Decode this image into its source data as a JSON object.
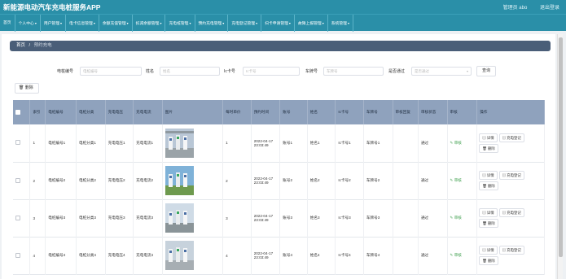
{
  "app": {
    "title": "新能源电动汽车充电桩服务APP",
    "user_links": [
      "管理员 abo",
      "退出登录"
    ]
  },
  "nav": [
    "首页",
    "个人中心",
    "用户管理",
    "电卡信息管理",
    "余额充值管理",
    "扣减余额管理",
    "充电桩管理",
    "预约充电管理",
    "充电登记管理",
    "扫卡申请管理",
    "故障上报管理",
    "系统管理"
  ],
  "nav_dropdown": [
    false,
    true,
    true,
    true,
    true,
    true,
    true,
    true,
    true,
    true,
    true,
    true
  ],
  "breadcrumb": {
    "home": "首页",
    "sep": "/",
    "current": "预约充电"
  },
  "filters": {
    "pile_no_label": "电桩编号",
    "pile_no_placeholder": "电桩编号",
    "name_label": "姓名",
    "name_placeholder": "姓名",
    "card_label": "Ic卡号",
    "card_placeholder": "Ic卡号",
    "plate_label": "车牌号",
    "plate_placeholder": "车牌号",
    "passed_label": "是否通过",
    "passed_placeholder": "是否通过",
    "search_button": "查询"
  },
  "delete_button": "删除",
  "table": {
    "headers": [
      "索引",
      "电桩编号",
      "电桩分类",
      "充电电压",
      "充电电流",
      "图片",
      "每时单价",
      "预约时间",
      "账号",
      "姓名",
      "Ic卡号",
      "车牌号",
      "审核回复",
      "审核状态",
      "审核",
      "操作"
    ],
    "rows": [
      {
        "index": "1",
        "pile_no": "电桩编号1",
        "category": "电桩分类1",
        "voltage": "充电电压1",
        "current": "充电电流1",
        "price": "1",
        "time": "2022-04-17 23:03:49",
        "account": "账号1",
        "name": "姓名1",
        "card": "Ic卡号1",
        "plate": "车牌号1",
        "reply": "",
        "status": "通过",
        "audit": "审核"
      },
      {
        "index": "2",
        "pile_no": "电桩编号2",
        "category": "电桩分类2",
        "voltage": "充电电压2",
        "current": "充电电流2",
        "price": "2",
        "time": "2022-04-17 23:03:49",
        "account": "账号2",
        "name": "姓名2",
        "card": "Ic卡号2",
        "plate": "车牌号2",
        "reply": "",
        "status": "通过",
        "audit": "审核"
      },
      {
        "index": "3",
        "pile_no": "电桩编号3",
        "category": "电桩分类3",
        "voltage": "充电电压3",
        "current": "充电电流3",
        "price": "3",
        "time": "2022-04-17 23:03:49",
        "account": "账号3",
        "name": "姓名3",
        "card": "Ic卡号3",
        "plate": "车牌号3",
        "reply": "",
        "status": "通过",
        "audit": "审核"
      },
      {
        "index": "4",
        "pile_no": "电桩编号4",
        "category": "电桩分类4",
        "voltage": "充电电压4",
        "current": "充电电流4",
        "price": "4",
        "time": "2022-04-17 23:03:49",
        "account": "账号4",
        "name": "姓名4",
        "card": "Ic卡号4",
        "plate": "车牌号4",
        "reply": "",
        "status": "通过",
        "audit": "审核"
      }
    ],
    "actions": [
      "详情",
      "充电登记",
      "删除"
    ]
  },
  "colors": {
    "header": "#2a8fa8",
    "breadcrumb": "#4a5e78",
    "table_head": "#8fa2bd",
    "audit": "#3b9d4a"
  }
}
